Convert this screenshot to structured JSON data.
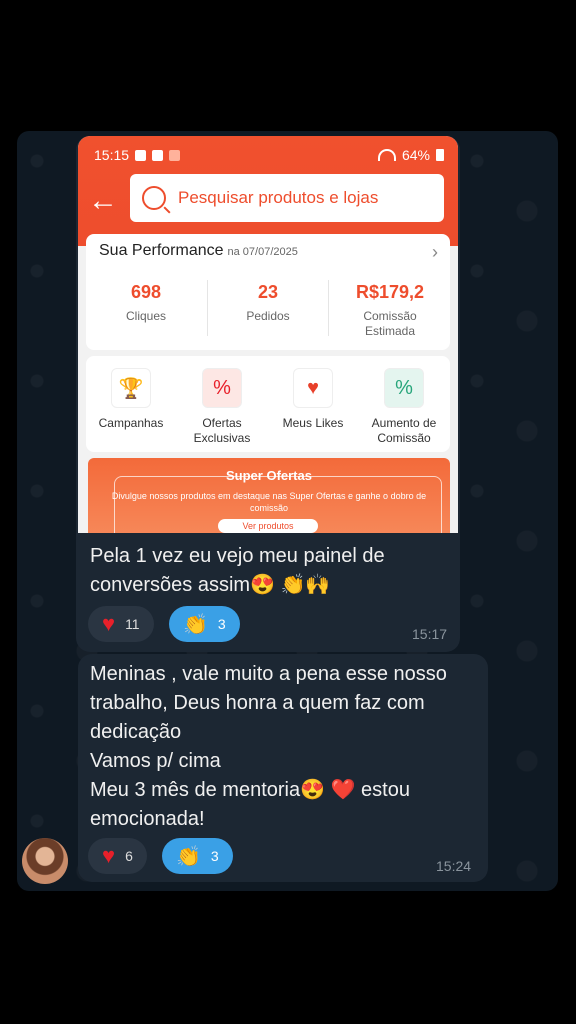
{
  "screenshot": {
    "status_bar": {
      "time": "15:15",
      "battery": "64%"
    },
    "search_placeholder": "Pesquisar produtos e lojas",
    "performance": {
      "title": "Sua Performance",
      "date": "na 07/07/2025",
      "stats": [
        {
          "value": "698",
          "label": "Cliques"
        },
        {
          "value": "23",
          "label": "Pedidos"
        },
        {
          "value": "R$179,2",
          "label": "Comissão Estimada"
        }
      ]
    },
    "shortcuts": [
      {
        "label": "Campanhas",
        "icon": "trophy-icon"
      },
      {
        "label": "Ofertas Exclusivas",
        "icon": "handshake-icon"
      },
      {
        "label": "Meus Likes",
        "icon": "heart-icon"
      },
      {
        "label": "Aumento de Comissão",
        "icon": "percent-icon"
      }
    ],
    "super_offers": {
      "title": "Super Ofertas",
      "description": "Divulgue nossos produtos em destaque nas Super Ofertas e ganhe o dobro de comissão",
      "button": "Ver produtos"
    }
  },
  "messages": [
    {
      "text": "Pela 1 vez eu vejo meu painel de conversões assim😍 👏🙌",
      "reactions": [
        {
          "emoji": "❤️",
          "count": "11"
        },
        {
          "emoji": "👏",
          "count": "3"
        }
      ],
      "time": "15:17"
    },
    {
      "text_lines": [
        "Meninas , vale muito a pena esse nosso",
        "trabalho,  Deus honra a quem faz com",
        "dedicação",
        "Vamos p/ cima",
        "Meu 3 mês de mentoria😍 ❤️ estou",
        "emocionada!"
      ],
      "reactions": [
        {
          "emoji": "❤️",
          "count": "6"
        },
        {
          "emoji": "👏",
          "count": "3"
        }
      ],
      "time": "15:24"
    }
  ]
}
